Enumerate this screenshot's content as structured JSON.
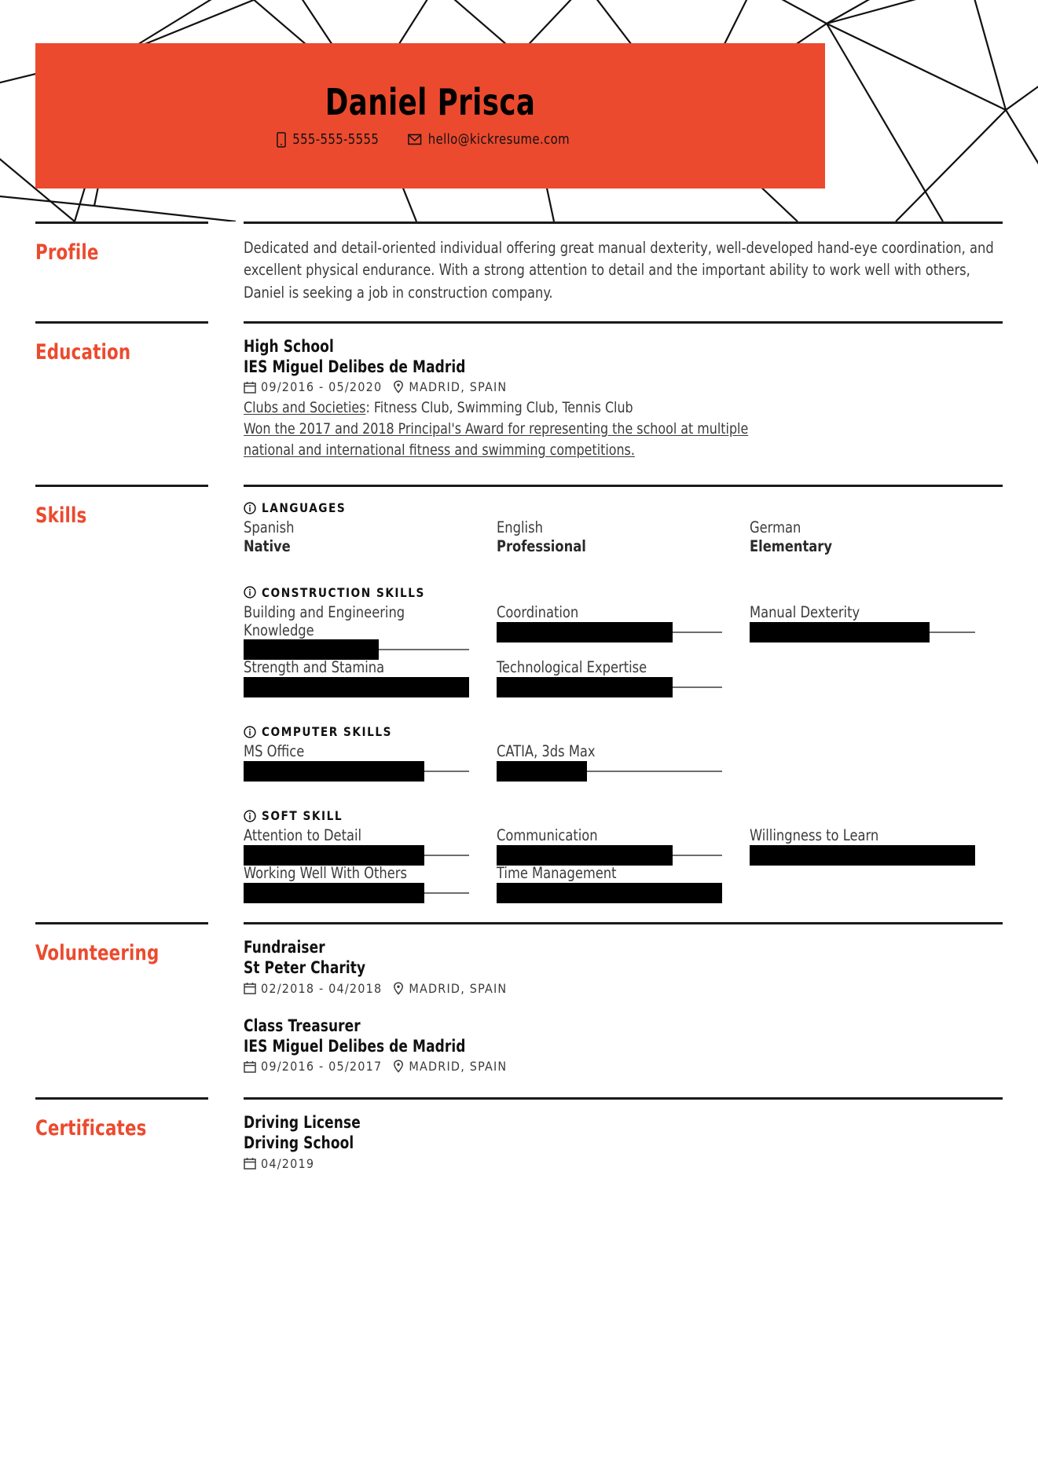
{
  "theme": {
    "accent": "#ec4a2e",
    "ink": "#111111",
    "body_text": "#3b3b3b",
    "bar_fill": "#000000",
    "bar_track": "#6d6d6d"
  },
  "header": {
    "name": "Daniel Prisca",
    "phone": "555-555-5555",
    "email": "hello@kickresume.com",
    "phone_icon": "mobile-phone-icon",
    "email_icon": "envelope-icon"
  },
  "sections": {
    "profile": {
      "title": "Profile",
      "text": "Dedicated and detail-oriented individual offering great manual dexterity, well-developed hand-eye coordination, and excellent physical endurance. With a strong attention to detail and the important ability to work well with others, Daniel is seeking a job in construction company."
    },
    "education": {
      "title": "Education",
      "entries": [
        {
          "title": "High School",
          "organization": "IES Miguel Delibes de Madrid",
          "date": "09/2016 - 05/2020",
          "location": "MADRID, SPAIN",
          "clubs_label": "Clubs and Societies",
          "clubs_value": ": Fitness Club, Swimming Club, Tennis Club",
          "award_line_1": "Won the 2017 and 2018 Principal's Award for representing the school at multiple",
          "award_line_2": "national and international fitness and swimming competitions."
        }
      ]
    },
    "skills": {
      "title": "Skills",
      "groups": [
        {
          "label": "LANGUAGES",
          "type": "languages",
          "items": [
            {
              "name": "Spanish",
              "level": "Native"
            },
            {
              "name": "English",
              "level": "Professional"
            },
            {
              "name": "German",
              "level": "Elementary"
            }
          ]
        },
        {
          "label": "CONSTRUCTION SKILLS",
          "type": "bars",
          "items": [
            {
              "name": "Building and Engineering Knowledge",
              "value": 60
            },
            {
              "name": "Coordination",
              "value": 78
            },
            {
              "name": "Manual Dexterity",
              "value": 80
            },
            {
              "name": "Strength and Stamina",
              "value": 100
            },
            {
              "name": "Technological Expertise",
              "value": 78
            }
          ]
        },
        {
          "label": "COMPUTER SKILLS",
          "type": "bars",
          "items": [
            {
              "name": "MS Office",
              "value": 80
            },
            {
              "name": "CATIA, 3ds Max",
              "value": 40
            }
          ]
        },
        {
          "label": "SOFT SKILL",
          "type": "bars",
          "items": [
            {
              "name": "Attention to Detail",
              "value": 80
            },
            {
              "name": "Communication",
              "value": 78
            },
            {
              "name": "Willingness to Learn",
              "value": 100
            },
            {
              "name": "Working Well With Others",
              "value": 80
            },
            {
              "name": "Time Management",
              "value": 100
            }
          ]
        }
      ]
    },
    "volunteering": {
      "title": "Volunteering",
      "entries": [
        {
          "title": "Fundraiser",
          "organization": "St Peter Charity",
          "date": "02/2018 - 04/2018",
          "location": "MADRID, SPAIN"
        },
        {
          "title": "Class Treasurer",
          "organization": "IES Miguel Delibes de Madrid",
          "date": "09/2016 - 05/2017",
          "location": "MADRID, SPAIN"
        }
      ]
    },
    "certificates": {
      "title": "Certificates",
      "entries": [
        {
          "title": "Driving License",
          "organization": "Driving School",
          "date": "04/2019"
        }
      ]
    }
  }
}
